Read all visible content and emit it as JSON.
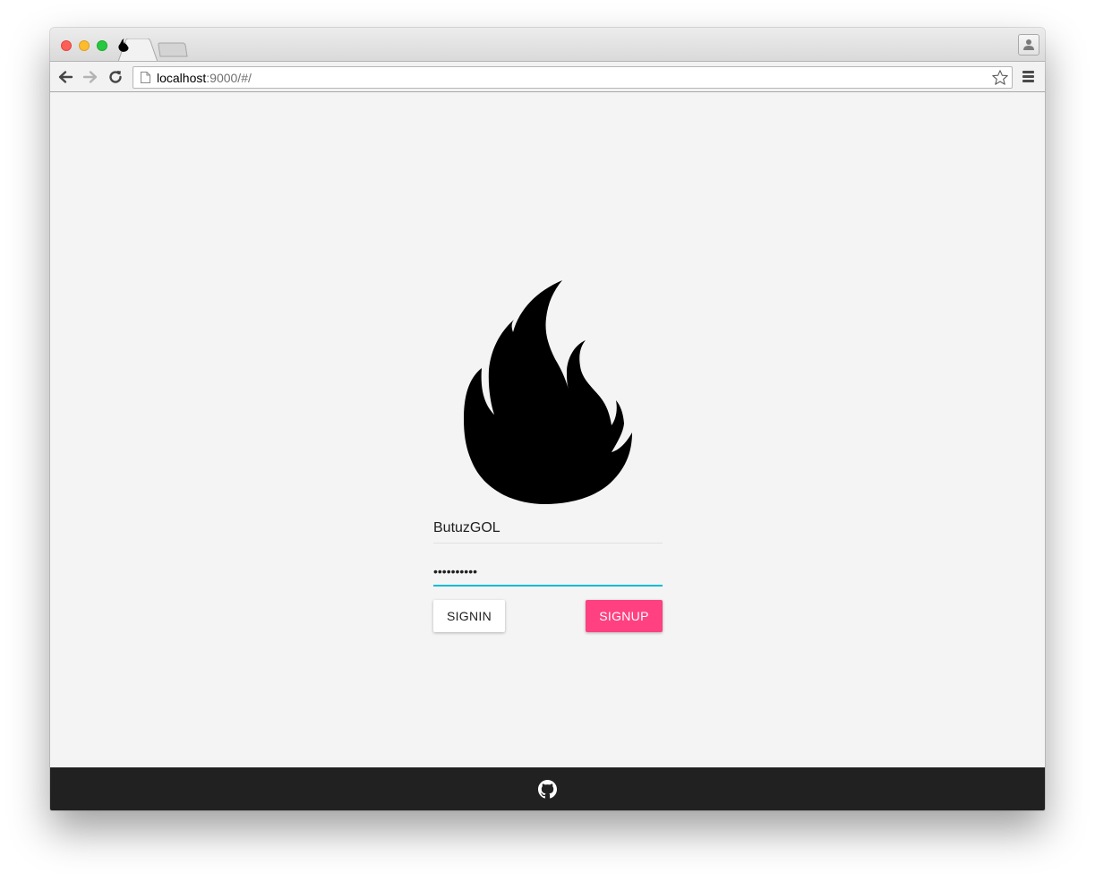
{
  "browser": {
    "url_host": "localhost",
    "url_rest": ":9000/#/",
    "tab_favicon": "flame-icon",
    "icons": {
      "back": "arrow-left-icon",
      "forward": "arrow-right-icon",
      "reload": "reload-icon",
      "page": "page-icon",
      "bookmark": "star-icon",
      "menu": "hamburger-menu-icon",
      "profile": "person-icon"
    }
  },
  "login": {
    "logo": "flame-icon",
    "username_value": "ButuzGOL",
    "password_value": "••••••••••",
    "signin_label": "SIGNIN",
    "signup_label": "SIGNUP"
  },
  "footer": {
    "icon": "github-icon"
  },
  "colors": {
    "accent_underline": "#00bcd4",
    "signup_button": "#ff4081",
    "footer_bg": "#212121",
    "page_bg": "#f4f4f4"
  }
}
